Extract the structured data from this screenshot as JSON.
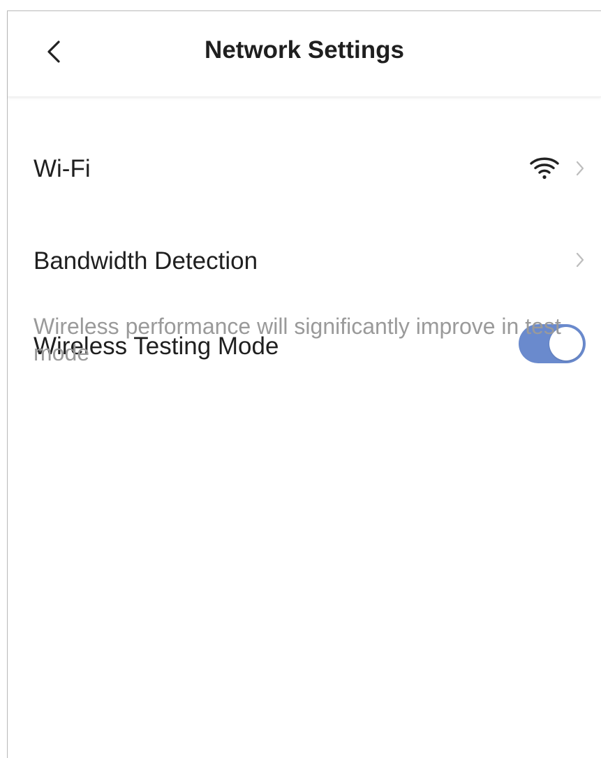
{
  "header": {
    "title": "Network Settings",
    "back_icon": "chevron-left-icon"
  },
  "rows": {
    "wifi": {
      "label": "Wi-Fi",
      "icon": "wifi-icon",
      "chevron": "chevron-right-icon"
    },
    "bandwidth": {
      "label": "Bandwidth Detection",
      "chevron": "chevron-right-icon"
    },
    "wireless_testing": {
      "label": "Wireless Testing Mode",
      "toggle_on": true,
      "description": "Wireless performance will significantly improve in test mode"
    }
  },
  "colors": {
    "toggle_on": "#6a8acd",
    "text_primary": "#1f1f1f",
    "text_secondary": "#9a9a9a",
    "chevron": "#bdbdbd"
  }
}
